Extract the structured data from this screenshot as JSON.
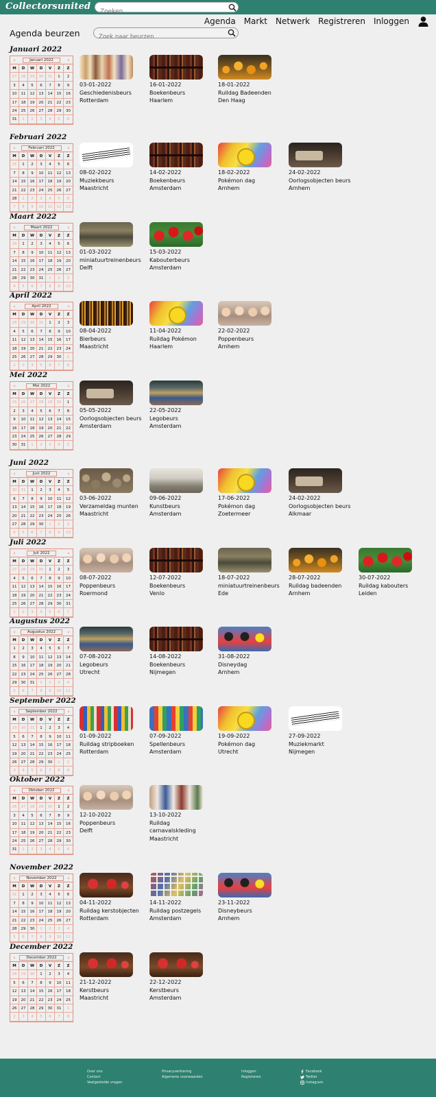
{
  "header": {
    "logo": "Collectorsunited",
    "search_placeholder": "Zoeken",
    "nav": [
      "Agenda",
      "Markt",
      "Netwerk",
      "Registreren",
      "Inloggen"
    ]
  },
  "page": {
    "title": "Agenda beurzen",
    "search_placeholder": "Zoek naar beurzen"
  },
  "weekdays": [
    "M",
    "D",
    "W",
    "D",
    "V",
    "Z",
    "Z"
  ],
  "months": [
    {
      "title": "Januari 2022",
      "label": "Januari 2022",
      "offset": 5,
      "days": 31,
      "events": [
        {
          "date": "03-01-2022",
          "name": "Geschiedenisbeurs",
          "city": "Rotterdam",
          "img": "people"
        },
        {
          "date": "16-01-2022",
          "name": "Boekenbeurs",
          "city": "Haarlem",
          "img": "books"
        },
        {
          "date": "18-01-2022",
          "name": "Ruildag Badeenden",
          "city": "Den Haag",
          "img": "ducks"
        }
      ]
    },
    {
      "title": "Februari 2022",
      "label": "Februari 2022",
      "offset": 1,
      "days": 28,
      "events": [
        {
          "date": "08-02-2022",
          "name": "Muziekbeurs",
          "city": "Maastricht",
          "img": "music"
        },
        {
          "date": "14-02-2022",
          "name": "Boekenbeurs",
          "city": "Amsterdam",
          "img": "books"
        },
        {
          "date": "18-02-2022",
          "name": "Pokémon dag",
          "city": "Arnhem",
          "img": "pokemon"
        },
        {
          "date": "24-02-2022",
          "name": "Oorlogsobjecten beurs",
          "city": "Arnhem",
          "img": "war"
        }
      ]
    },
    {
      "title": "Maart 2022",
      "label": "Maart 2022",
      "offset": 1,
      "days": 31,
      "events": [
        {
          "date": "01-03-2022",
          "name": "miniatuurtreinenbeurs",
          "city": "Delft",
          "img": "train"
        },
        {
          "date": "15-03-2022",
          "name": "Kabouterbeurs",
          "city": "Amsterdam",
          "img": "gnome"
        }
      ]
    },
    {
      "title": "April 2022",
      "label": "April 2022",
      "offset": 4,
      "days": 30,
      "events": [
        {
          "date": "08-04-2022",
          "name": "Bierbeurs",
          "city": "Maastricht",
          "img": "beer"
        },
        {
          "date": "11-04-2022",
          "name": "Ruildag Pokémon",
          "city": "Haarlem",
          "img": "pokemon"
        },
        {
          "date": "22-02-2022",
          "name": "Poppenbeurs",
          "city": "Arnhem",
          "img": "dolls"
        }
      ]
    },
    {
      "title": "Mei 2022",
      "label": "Mei 2022",
      "offset": 6,
      "days": 31,
      "events": [
        {
          "date": "05-05-2022",
          "name": "Oorlogsobjecten beurs",
          "city": "Amsterdam",
          "img": "war"
        },
        {
          "date": "22-05-2022",
          "name": "Legobeurs",
          "city": "Amsterdam",
          "img": "lego"
        }
      ]
    },
    {
      "title": "Juni 2022",
      "label": "Juni 2022",
      "offset": 2,
      "days": 30,
      "events": [
        {
          "date": "03-06-2022",
          "name": "Verzameldag munten",
          "city": "Maastricht",
          "img": "coins"
        },
        {
          "date": "09-06-2022",
          "name": "Kunstbeurs",
          "city": "Amsterdam",
          "img": "art"
        },
        {
          "date": "17-06-2022",
          "name": "Pokémon dag",
          "city": "Zoetermeer",
          "img": "pokemon"
        },
        {
          "date": "24-02-2022",
          "name": "Oorlogsobjecten beurs",
          "city": "Alkmaar",
          "img": "war"
        }
      ]
    },
    {
      "title": "Juli 2022",
      "label": "Juli 2022",
      "offset": 4,
      "days": 31,
      "events": [
        {
          "date": "08-07-2022",
          "name": "Poppenbeurs",
          "city": "Roermond",
          "img": "dolls"
        },
        {
          "date": "12-07-2022",
          "name": "Boekenbeurs",
          "city": "Venlo",
          "img": "books"
        },
        {
          "date": "18-07-2022",
          "name": "miniatuurtreinenbeurs",
          "city": "Ede",
          "img": "train"
        },
        {
          "date": "28-07-2022",
          "name": "Ruildag badeenden",
          "city": "Arnhem",
          "img": "ducks"
        },
        {
          "date": "30-07-2022",
          "name": "Ruildag kabouters",
          "city": "Leiden",
          "img": "gnome"
        }
      ]
    },
    {
      "title": "Augustus 2022",
      "label": "Augustus 2022",
      "offset": 0,
      "days": 31,
      "events": [
        {
          "date": "07-08-2022",
          "name": "Legobeurs",
          "city": "Utrecht",
          "img": "lego"
        },
        {
          "date": "14-08-2022",
          "name": "Boekenbeurs",
          "city": "Nijmegen",
          "img": "books"
        },
        {
          "date": "31-08-2022",
          "name": "Disneydag",
          "city": "Arnhem",
          "img": "disney"
        }
      ]
    },
    {
      "title": "September 2022",
      "label": "September 2022",
      "offset": 3,
      "days": 30,
      "events": [
        {
          "date": "01-09-2022",
          "name": "Ruildag stripboeken",
          "city": "Rotterdam",
          "img": "comics"
        },
        {
          "date": "07-09-2022",
          "name": "Spellenbeurs",
          "city": "Amsterdam",
          "img": "games"
        },
        {
          "date": "19-09-2022",
          "name": "Pokémon dag",
          "city": "Utrecht",
          "img": "pokemon"
        },
        {
          "date": "27-09-2022",
          "name": "Muziekmarkt",
          "city": "Nijmegen",
          "img": "music"
        }
      ]
    },
    {
      "title": "Oktober 2022",
      "label": "Oktober 2022",
      "offset": 5,
      "days": 31,
      "events": [
        {
          "date": "12-10-2022",
          "name": "Poppenbeurs",
          "city": "Delft",
          "img": "dolls"
        },
        {
          "date": "13-10-2022",
          "name": "Ruildag carnavalskleding",
          "city": "Maastricht",
          "img": "carnival"
        }
      ]
    },
    {
      "title": "November 2022",
      "label": "November 2022",
      "offset": 1,
      "days": 30,
      "events": [
        {
          "date": "04-11-2022",
          "name": "Ruildag kerstobjecten",
          "city": "Rotterdam",
          "img": "xmas"
        },
        {
          "date": "14-11-2022",
          "name": "Ruildag postzegels",
          "city": "Amsterdam",
          "img": "stamps"
        },
        {
          "date": "23-11-2022",
          "name": "Disneybeurs",
          "city": "Arnhem",
          "img": "disney"
        }
      ]
    },
    {
      "title": "December 2022",
      "label": "December 2022",
      "offset": 3,
      "days": 31,
      "events": [
        {
          "date": "21-12-2022",
          "name": "Kerstbeurs",
          "city": "Maastricht",
          "img": "xmas"
        },
        {
          "date": "22-12-2022",
          "name": "Kerstbeurs",
          "city": "Amsterdam",
          "img": "xmas"
        }
      ]
    }
  ],
  "footer": {
    "col1": [
      "Over ons",
      "Contact",
      "Veelgestelde vragen"
    ],
    "col2": [
      "Privacyverklaring",
      "Algemene voorwaarden"
    ],
    "col3": [
      "Inloggen",
      "Registreren"
    ],
    "social": [
      {
        "label": "Facebook",
        "icon": "facebook-icon"
      },
      {
        "label": "Twitter",
        "icon": "twitter-icon"
      },
      {
        "label": "Instagram",
        "icon": "instagram-icon"
      }
    ]
  },
  "colors": {
    "brand": "#2e8170",
    "calendar_border": "#e09080",
    "background": "#efefef"
  }
}
